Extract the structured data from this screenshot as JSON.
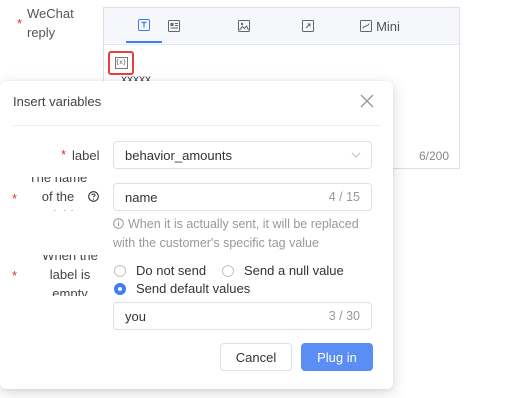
{
  "background": {
    "field_label": [
      "WeChat",
      "reply"
    ],
    "editor": {
      "tabs": [
        {
          "icon": "text-icon",
          "active": true
        },
        {
          "icon": "image-text-icon",
          "active": false
        },
        {
          "icon": "image-icon",
          "active": false
        },
        {
          "icon": "link-icon",
          "active": false
        },
        {
          "icon": "miniprogram-icon",
          "label": "Mini",
          "active": false
        }
      ],
      "variable_button_text": "{x}",
      "content": "xxxxx",
      "char_count": "6/200"
    }
  },
  "dialog": {
    "title": "Insert variables",
    "label_field": {
      "label": "label",
      "value": "behavior_amounts"
    },
    "name_field": {
      "label_lines": [
        "The name",
        "of the",
        "variable"
      ],
      "value": "name",
      "count": "4 / 15"
    },
    "hint": "When it is actually sent, it will be replaced with the customer's specific tag value",
    "empty_field": {
      "label_lines": [
        "When the",
        "label is",
        "empty"
      ],
      "options": [
        {
          "label": "Do not send",
          "checked": false
        },
        {
          "label": "Send a null value",
          "checked": false
        },
        {
          "label": "Send default values",
          "checked": true
        }
      ],
      "default_value": "you",
      "default_count": "3 / 30"
    },
    "cancel_label": "Cancel",
    "confirm_label": "Plug in"
  },
  "colors": {
    "accent": "#3f7cf7",
    "primary_button": "#5b8ef5",
    "required": "#e0302a",
    "highlight_box": "#e8403a"
  }
}
